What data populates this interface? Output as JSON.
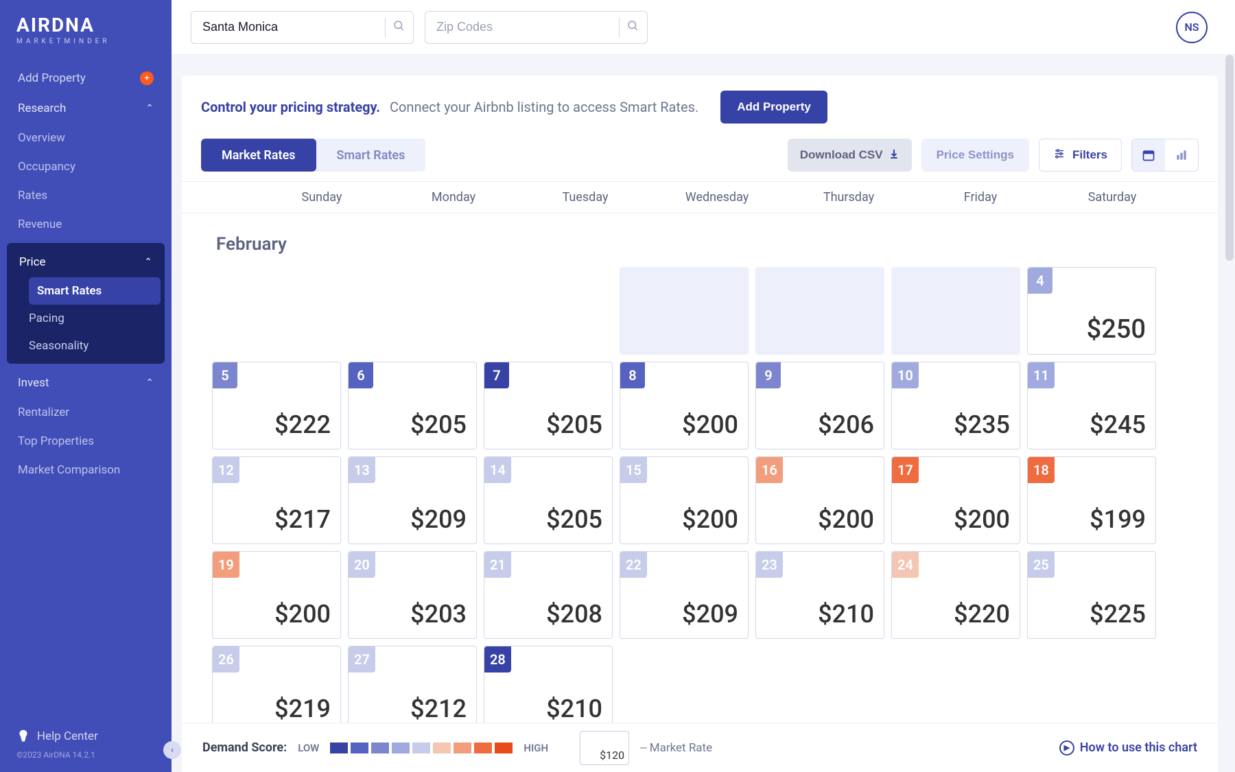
{
  "brand": {
    "name": "AIRDNA",
    "tag": "MARKETMINDER"
  },
  "search": {
    "market_value": "Santa Monica",
    "zip_placeholder": "Zip Codes"
  },
  "user": {
    "initials": "NS"
  },
  "sidebar": {
    "addProperty": "Add Property",
    "research": {
      "label": "Research",
      "items": [
        "Overview",
        "Occupancy",
        "Rates",
        "Revenue"
      ]
    },
    "price": {
      "label": "Price",
      "items": [
        "Smart Rates",
        "Pacing",
        "Seasonality"
      ],
      "activeIndex": 0
    },
    "invest": {
      "label": "Invest",
      "items": [
        "Rentalizer",
        "Top Properties",
        "Market Comparison"
      ]
    },
    "help": "Help Center",
    "copyright": "©2023 AirDNA 14.2.1"
  },
  "banner": {
    "title": "Control your pricing strategy.",
    "subtitle": "Connect your Airbnb listing to access Smart Rates.",
    "cta": "Add Property"
  },
  "toolbar": {
    "tabs": [
      "Market Rates",
      "Smart Rates"
    ],
    "activeTab": 0,
    "download": "Download CSV",
    "priceSettings": "Price Settings",
    "filters": "Filters"
  },
  "week": [
    "Sunday",
    "Monday",
    "Tuesday",
    "Wednesday",
    "Thursday",
    "Friday",
    "Saturday"
  ],
  "calendar": {
    "monthLabel": "February",
    "leadingShaded": [
      false,
      false,
      false,
      true,
      true,
      true
    ],
    "days": [
      {
        "d": 4,
        "price": "$250",
        "demand": 3,
        "strong": true
      },
      {
        "d": 5,
        "price": "$222",
        "demand": 2
      },
      {
        "d": 6,
        "price": "$205",
        "demand": 1
      },
      {
        "d": 7,
        "price": "$205",
        "demand": 0
      },
      {
        "d": 8,
        "price": "$200",
        "demand": 1
      },
      {
        "d": 9,
        "price": "$206",
        "demand": 2
      },
      {
        "d": 10,
        "price": "$235",
        "demand": 3
      },
      {
        "d": 11,
        "price": "$245",
        "demand": 3
      },
      {
        "d": 12,
        "price": "$217",
        "demand": 4
      },
      {
        "d": 13,
        "price": "$209",
        "demand": 4
      },
      {
        "d": 14,
        "price": "$205",
        "demand": 4
      },
      {
        "d": 15,
        "price": "$200",
        "demand": 4
      },
      {
        "d": 16,
        "price": "$200",
        "demand": 6
      },
      {
        "d": 17,
        "price": "$200",
        "demand": 7
      },
      {
        "d": 18,
        "price": "$199",
        "demand": 7
      },
      {
        "d": 19,
        "price": "$200",
        "demand": 6
      },
      {
        "d": 20,
        "price": "$203",
        "demand": 4
      },
      {
        "d": 21,
        "price": "$208",
        "demand": 4
      },
      {
        "d": 22,
        "price": "$209",
        "demand": 4
      },
      {
        "d": 23,
        "price": "$210",
        "demand": 4
      },
      {
        "d": 24,
        "price": "$220",
        "demand": 5
      },
      {
        "d": 25,
        "price": "$225",
        "demand": 4
      },
      {
        "d": 26,
        "price": "$219",
        "demand": 4
      },
      {
        "d": 27,
        "price": "$212",
        "demand": 4
      },
      {
        "d": 28,
        "price": "$210",
        "demand": 0
      }
    ]
  },
  "legend": {
    "label": "Demand Score:",
    "low": "LOW",
    "high": "HIGH",
    "sample": "$120",
    "sampleLabel": "-- Market Rate",
    "howto": "How to use this chart",
    "colors": [
      "#3742a6",
      "#5662bf",
      "#7b86ce",
      "#a1aade",
      "#c7ccea",
      "#f4c6b4",
      "#f29e7c",
      "#ee6c3f",
      "#e84a1c"
    ]
  }
}
